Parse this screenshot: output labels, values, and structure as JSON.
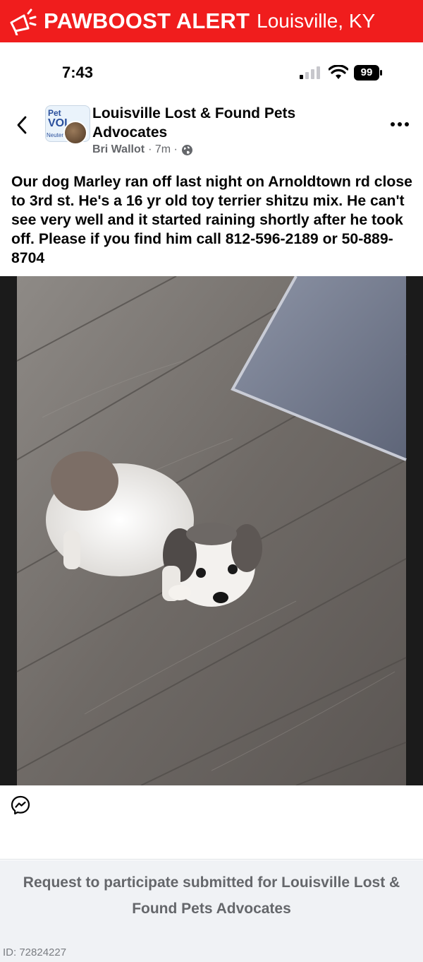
{
  "alert": {
    "brand": "PAWBOOST ALERT",
    "location": "Louisville, KY",
    "color": "#f01d1d"
  },
  "status": {
    "time": "7:43",
    "battery": "99"
  },
  "post": {
    "group_name": "Louisville Lost & Found Pets Advocates",
    "group_avatar_text": [
      "Pet",
      "VOI",
      "Neuter"
    ],
    "author": "Bri Wallot",
    "time_ago": "· 7m ·",
    "body": "Our dog Marley ran off last night on Arnoldtown rd close to 3rd st. He's a 16 yr old toy terrier shitzu mix. He can't see very well and it started raining shortly after he took off. Please if you find him call 812-596-2189 or 50-889-8704"
  },
  "request": {
    "text": "Request to participate submitted for Louisville Lost & Found Pets Advocates"
  },
  "footer": {
    "id": "ID: 72824227"
  },
  "icons": [
    "megaphone-icon",
    "signal-icon",
    "wifi-icon",
    "battery-icon",
    "back-chevron-icon",
    "globe-icon",
    "more-icon",
    "messenger-icon"
  ]
}
